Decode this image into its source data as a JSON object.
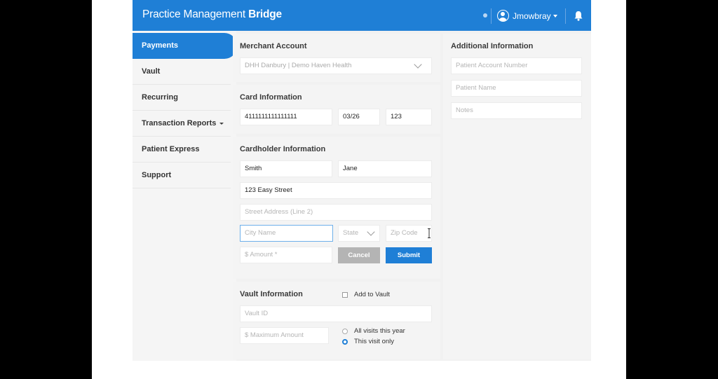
{
  "header": {
    "brand_regular": "Practice Management ",
    "brand_bold": "Bridge",
    "username": "Jmowbray"
  },
  "sidebar": {
    "items": [
      {
        "label": "Payments"
      },
      {
        "label": "Vault"
      },
      {
        "label": "Recurring"
      },
      {
        "label": "Transaction Reports"
      },
      {
        "label": "Patient Express"
      },
      {
        "label": "Support"
      }
    ]
  },
  "merchant": {
    "heading": "Merchant Account",
    "selected": "DHH Danbury | Demo Haven Health"
  },
  "card": {
    "heading": "Card Information",
    "number": "4111111111111111",
    "expiry": "03/26",
    "cvv": "123"
  },
  "cardholder": {
    "heading": "Cardholder Information",
    "last_name": "Smith",
    "first_name": "Jane",
    "address1": "123 Easy Street",
    "address2_placeholder": "Street Address (Line 2)",
    "city_placeholder": "City Name",
    "state_placeholder": "State",
    "zip_placeholder": "Zip Code",
    "amount_placeholder": "$ Amount *",
    "cancel_label": "Cancel",
    "submit_label": "Submit"
  },
  "vault": {
    "heading": "Vault Information",
    "add_label": "Add to Vault",
    "vault_id_placeholder": "Vault ID",
    "max_amount_placeholder": "$ Maximum Amount",
    "option_all": "All visits this year",
    "option_this": "This visit only",
    "selected_option": "This visit only"
  },
  "additional": {
    "heading": "Additional Information",
    "account_placeholder": "Patient Account Number",
    "name_placeholder": "Patient Name",
    "notes_placeholder": "Notes"
  },
  "colors": {
    "accent": "#1f7fd6",
    "cancel": "#b4b4b4"
  }
}
